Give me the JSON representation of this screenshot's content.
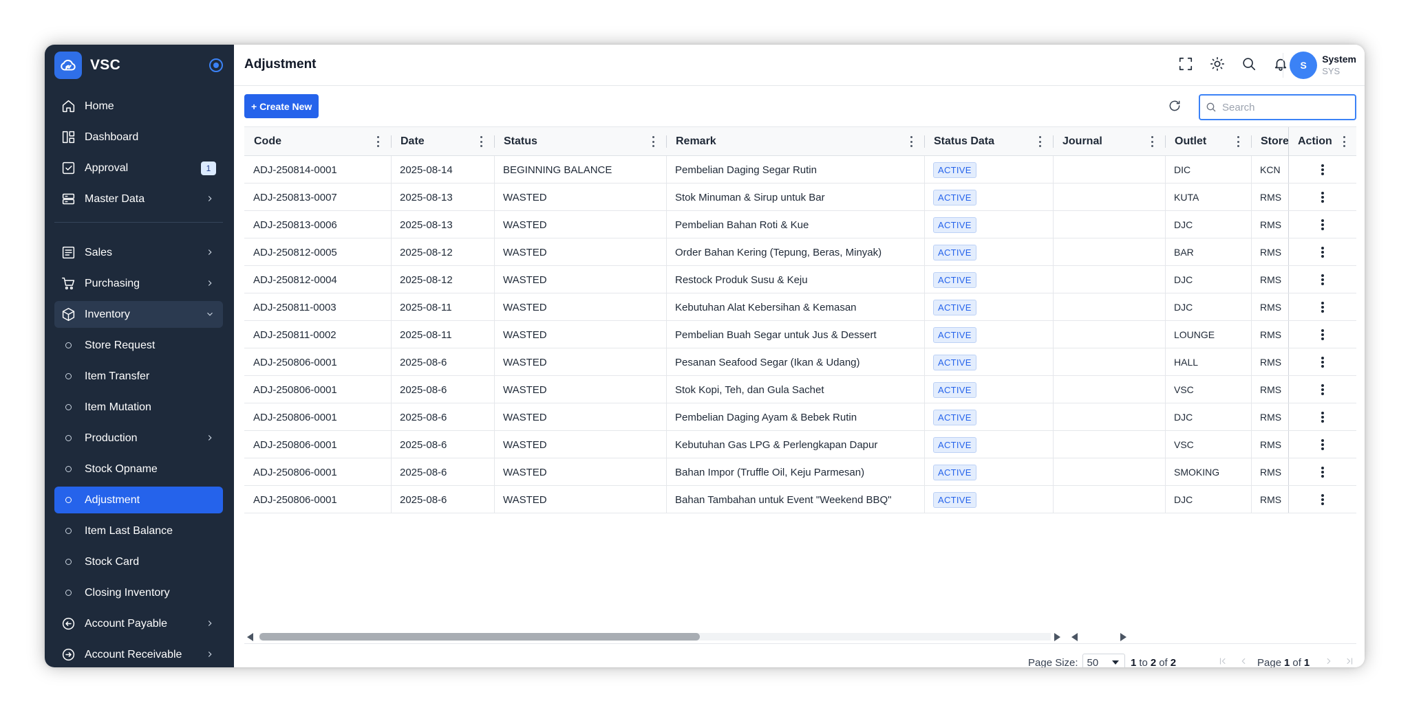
{
  "app": {
    "name": "VSC"
  },
  "sidebar": {
    "items": [
      {
        "label": "Home",
        "icon": "home-icon"
      },
      {
        "label": "Dashboard",
        "icon": "dashboard-icon"
      },
      {
        "label": "Approval",
        "icon": "approval-icon",
        "badge": "1"
      },
      {
        "label": "Master Data",
        "icon": "database-icon"
      },
      {
        "label": "Sales",
        "icon": "sales-icon"
      },
      {
        "label": "Purchasing",
        "icon": "cart-icon"
      },
      {
        "label": "Inventory",
        "icon": "box-icon"
      },
      {
        "label": "Store Request"
      },
      {
        "label": "Item Transfer"
      },
      {
        "label": "Item Mutation"
      },
      {
        "label": "Production"
      },
      {
        "label": "Stock Opname"
      },
      {
        "label": "Adjustment"
      },
      {
        "label": "Item Last Balance"
      },
      {
        "label": "Stock Card"
      },
      {
        "label": "Closing Inventory"
      },
      {
        "label": "Account Payable",
        "icon": "arrow-left-circle-icon"
      },
      {
        "label": "Account Receivable",
        "icon": "arrow-right-circle-icon"
      }
    ]
  },
  "header": {
    "title": "Adjustment"
  },
  "user": {
    "initial": "S",
    "name": "System",
    "code": "SYS"
  },
  "toolbar": {
    "create_label": "+ Create New"
  },
  "search": {
    "placeholder": "Search",
    "value": ""
  },
  "table": {
    "columns": [
      "Code",
      "Date",
      "Status",
      "Remark",
      "Status Data",
      "Journal",
      "Outlet",
      "Store",
      "Action"
    ],
    "rows": [
      {
        "code": "ADJ-250814-0001",
        "date": "2025-08-14",
        "status": "BEGINNING BALANCE",
        "remark": "Pembelian Daging Segar Rutin",
        "status_data": "ACTIVE",
        "journal": "",
        "outlet": "DIC",
        "store": "KCN"
      },
      {
        "code": "ADJ-250813-0007",
        "date": "2025-08-13",
        "status": "WASTED",
        "remark": "Stok Minuman & Sirup untuk Bar",
        "status_data": "ACTIVE",
        "journal": "",
        "outlet": "KUTA",
        "store": "RMS"
      },
      {
        "code": "ADJ-250813-0006",
        "date": "2025-08-13",
        "status": "WASTED",
        "remark": "Pembelian Bahan Roti & Kue",
        "status_data": "ACTIVE",
        "journal": "",
        "outlet": "DJC",
        "store": "RMS"
      },
      {
        "code": "ADJ-250812-0005",
        "date": "2025-08-12",
        "status": "WASTED",
        "remark": "Order Bahan Kering (Tepung, Beras, Minyak)",
        "status_data": "ACTIVE",
        "journal": "",
        "outlet": "BAR",
        "store": "RMS"
      },
      {
        "code": "ADJ-250812-0004",
        "date": "2025-08-12",
        "status": "WASTED",
        "remark": "Restock Produk Susu & Keju",
        "status_data": "ACTIVE",
        "journal": "",
        "outlet": "DJC",
        "store": "RMS"
      },
      {
        "code": "ADJ-250811-0003",
        "date": "2025-08-11",
        "status": "WASTED",
        "remark": "Kebutuhan Alat Kebersihan & Kemasan",
        "status_data": "ACTIVE",
        "journal": "",
        "outlet": "DJC",
        "store": "RMS"
      },
      {
        "code": "ADJ-250811-0002",
        "date": "2025-08-11",
        "status": "WASTED",
        "remark": "Pembelian Buah Segar untuk Jus & Dessert",
        "status_data": "ACTIVE",
        "journal": "",
        "outlet": "LOUNGE",
        "store": "RMS"
      },
      {
        "code": "ADJ-250806-0001",
        "date": "2025-08-6",
        "status": "WASTED",
        "remark": "Pesanan Seafood Segar (Ikan & Udang)",
        "status_data": "ACTIVE",
        "journal": "",
        "outlet": "HALL",
        "store": "RMS"
      },
      {
        "code": "ADJ-250806-0001",
        "date": "2025-08-6",
        "status": "WASTED",
        "remark": "Stok Kopi, Teh, dan Gula Sachet",
        "status_data": "ACTIVE",
        "journal": "",
        "outlet": "VSC",
        "store": "RMS"
      },
      {
        "code": "ADJ-250806-0001",
        "date": "2025-08-6",
        "status": "WASTED",
        "remark": "Pembelian Daging Ayam & Bebek Rutin",
        "status_data": "ACTIVE",
        "journal": "",
        "outlet": "DJC",
        "store": "RMS"
      },
      {
        "code": "ADJ-250806-0001",
        "date": "2025-08-6",
        "status": "WASTED",
        "remark": "Kebutuhan Gas LPG & Perlengkapan Dapur",
        "status_data": "ACTIVE",
        "journal": "",
        "outlet": "VSC",
        "store": "RMS"
      },
      {
        "code": "ADJ-250806-0001",
        "date": "2025-08-6",
        "status": "WASTED",
        "remark": "Bahan Impor (Truffle Oil, Keju Parmesan)",
        "status_data": "ACTIVE",
        "journal": "",
        "outlet": "SMOKING",
        "store": "RMS"
      },
      {
        "code": "ADJ-250806-0001",
        "date": "2025-08-6",
        "status": "WASTED",
        "remark": "Bahan Tambahan untuk Event \"Weekend BBQ\"",
        "status_data": "ACTIVE",
        "journal": "",
        "outlet": "DJC",
        "store": "RMS"
      }
    ]
  },
  "pagination": {
    "page_size_label": "Page Size:",
    "page_size": "50",
    "range_from": "1",
    "range_to_word": "to",
    "range_to": "2",
    "of_word": "of",
    "total": "2",
    "page_word": "Page",
    "page": "1",
    "pages": "1"
  },
  "colors": {
    "sidebar_bg": "#1e2a3b",
    "accent": "#2563eb",
    "chip_text": "#2563eb",
    "chip_bg": "#e3edfd"
  }
}
